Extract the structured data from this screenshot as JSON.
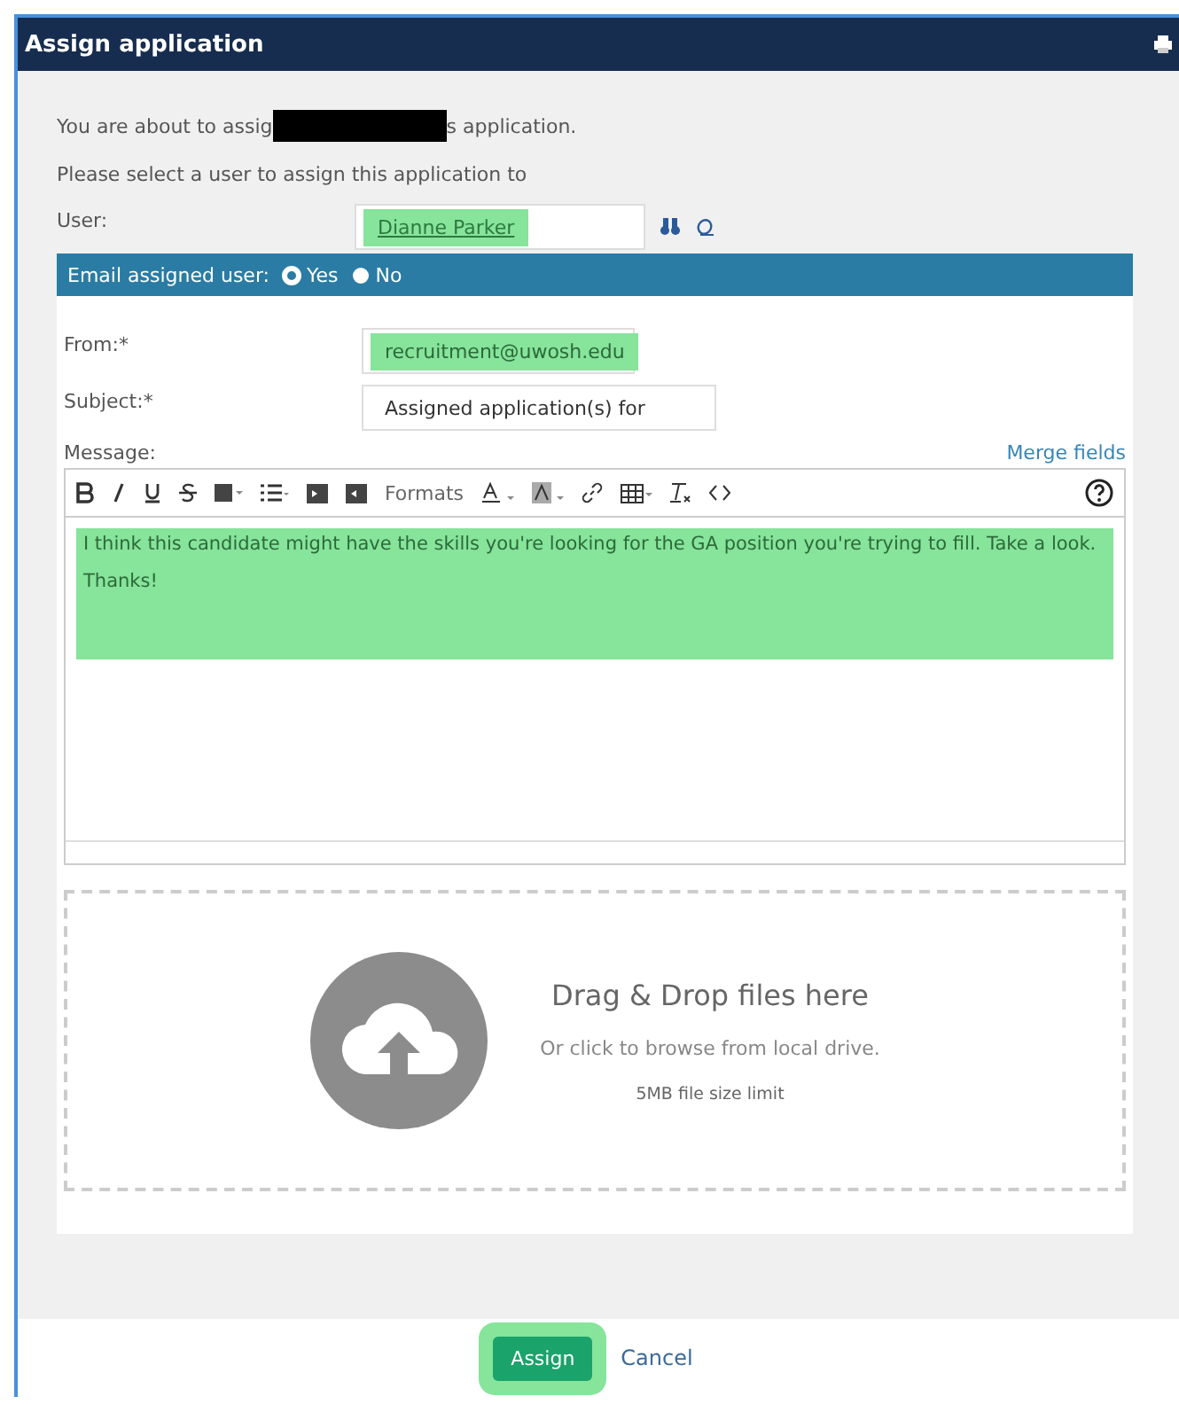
{
  "window": {
    "title": "Assign application"
  },
  "intro": {
    "before": "You are about to assig",
    "after": "s application."
  },
  "instruction": "Please select a user to assign this application to",
  "user": {
    "label": "User:",
    "value": "Dianne Parker"
  },
  "email_assigned_user": {
    "label": "Email assigned user:",
    "options": [
      {
        "label": "Yes",
        "selected": true
      },
      {
        "label": "No",
        "selected": false
      }
    ]
  },
  "from": {
    "label": "From:*",
    "value": "recruitment@uwosh.edu"
  },
  "subject": {
    "label": "Subject:*",
    "value": "Assigned application(s) for"
  },
  "message": {
    "label": "Message:",
    "merge_fields": "Merge fields",
    "formats": "Formats",
    "paragraphs": [
      "I think this candidate might have the skills you're looking for the GA position you're trying to fill. Take a look.",
      "Thanks!"
    ]
  },
  "dropzone": {
    "title": "Drag & Drop files here",
    "hint": "Or click to browse from local drive.",
    "limit": "5MB file size limit"
  },
  "buttons": [
    {
      "label": "Assign",
      "kind": "primary"
    },
    {
      "label": "Cancel",
      "kind": "link"
    }
  ]
}
